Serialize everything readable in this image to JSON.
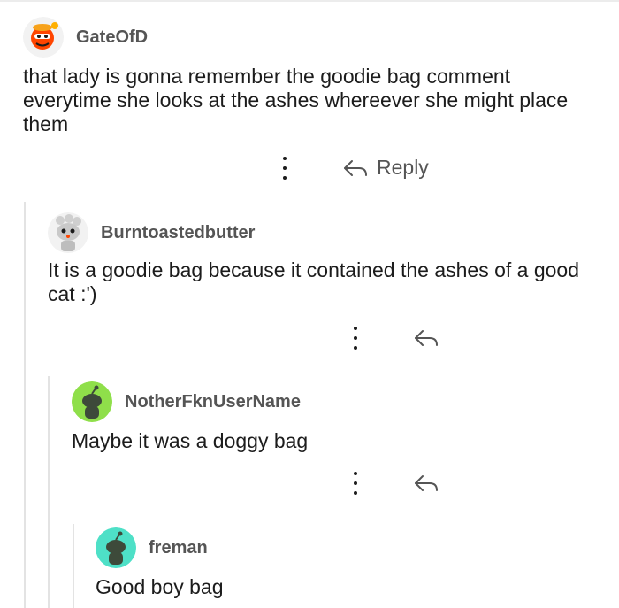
{
  "comments": [
    {
      "username": "GateOfD",
      "text": "that lady is gonna remember the goodie bag comment everytime she looks at the ashes whereever she might place them",
      "reply_label": "Reply",
      "avatar_color": "#ff4500"
    },
    {
      "username": "Burntoastedbutter",
      "text": "It is a goodie bag because it contained the ashes of a good cat :')",
      "avatar_color": "#d8d8d8"
    },
    {
      "username": "NotherFknUserName",
      "text": "Maybe it was a doggy bag",
      "avatar_color": "#8fdf4a"
    },
    {
      "username": "freman",
      "text": "Good boy bag",
      "avatar_color": "#4ee0c7"
    }
  ],
  "icons": {
    "more": "vertical-dots-icon",
    "reply": "reply-arrow-icon"
  }
}
